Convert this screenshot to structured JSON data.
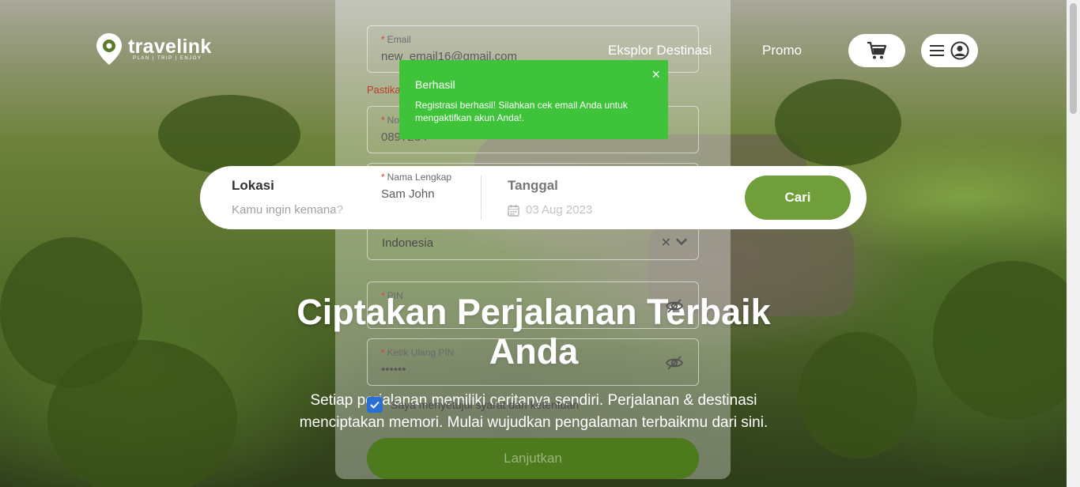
{
  "header": {
    "brand": "travelink",
    "tagline": "PLAN | TRIP | ENJOY",
    "nav": {
      "explore": "Eksplor Destinasi",
      "promo": "Promo"
    }
  },
  "search": {
    "location_label": "Lokasi",
    "location_placeholder": "Kamu ingin kemana?",
    "date_label": "Tanggal",
    "date_value": "03 Aug 2023",
    "button": "Cari"
  },
  "hero": {
    "title": "Ciptakan Perjalanan Terbaik Anda",
    "subtitle": "Setiap perjalanan memiliki ceritanya sendiri. Perjalanan & destinasi menciptakan memori. Mulai wujudkan pengalaman terbaikmu dari sini."
  },
  "registration": {
    "email_label": "Email",
    "email_value": "new_email16@gmail.com",
    "warning": "Pastika",
    "phone_label": "No",
    "phone_value": "0897234",
    "name_label": "Nama Lengkap",
    "name_value": "Sam John",
    "country_value": "Indonesia",
    "pin_label": "PIN",
    "pin_value": "",
    "pin_confirm_label": "Ketik Ulang PIN",
    "pin_confirm_value": "••••••",
    "agree_text": "Saya menyetujui syarat dan ketentuan",
    "submit": "Lanjutkan"
  },
  "toast": {
    "title": "Berhasil",
    "message": "Registrasi berhasil! Silahkan cek email Anda untuk mengaktifkan akun Anda!.",
    "close": "×"
  },
  "colors": {
    "accent_green": "#6f9e3a",
    "toast_green": "#3ec33a"
  }
}
